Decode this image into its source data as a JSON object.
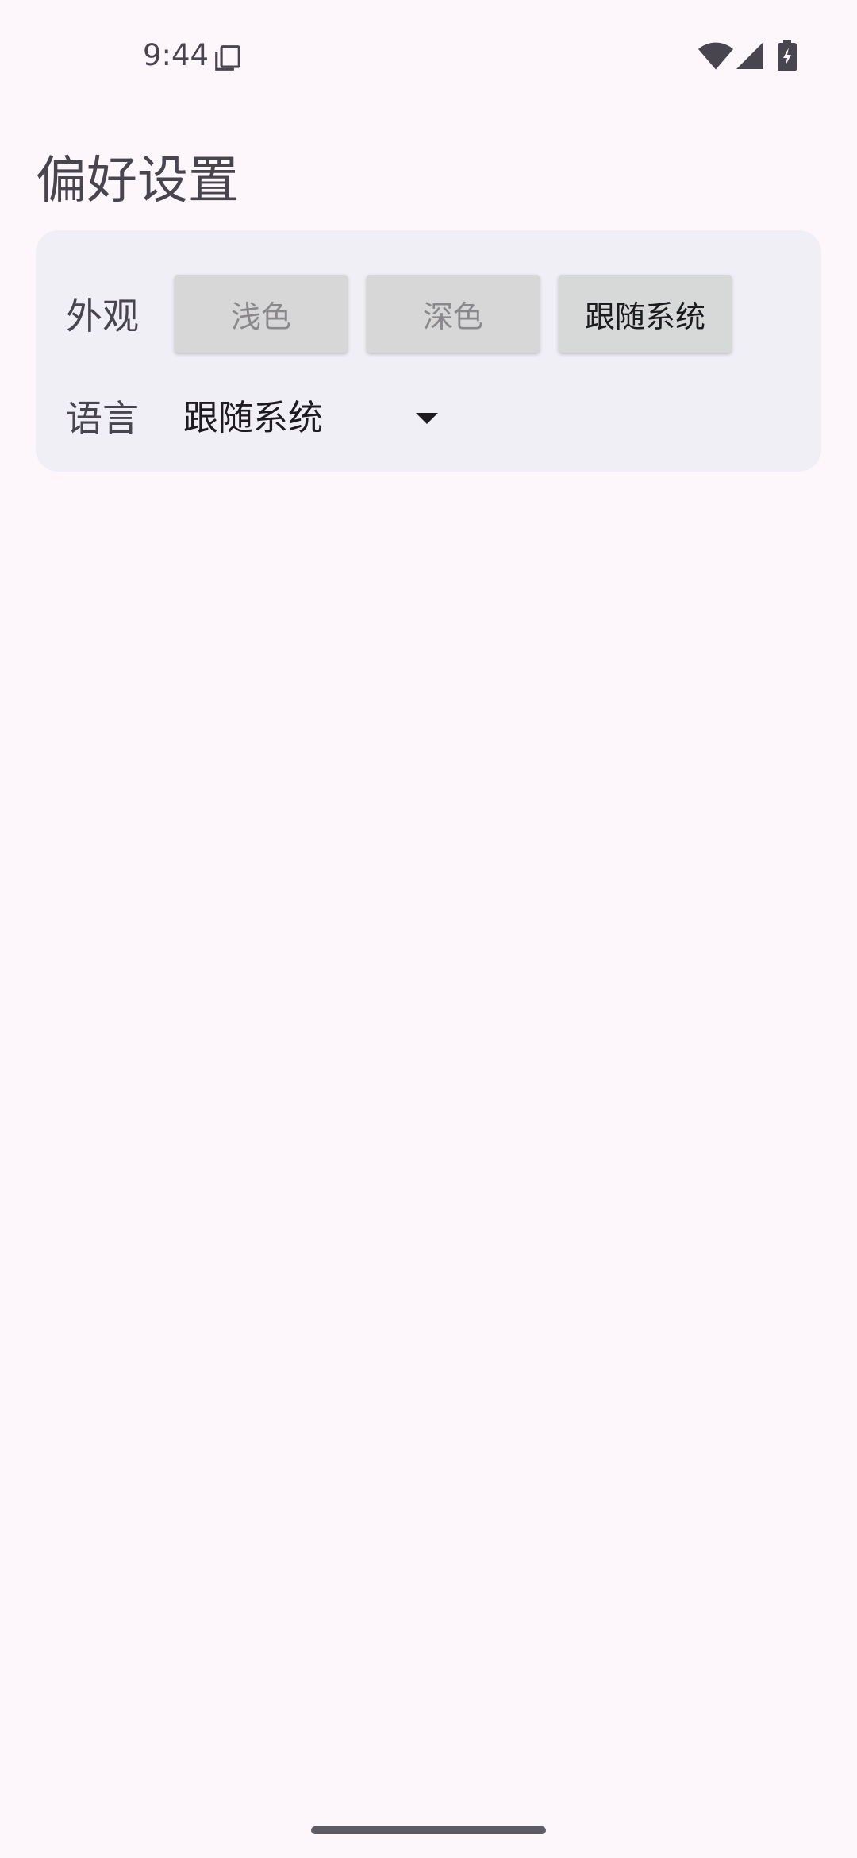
{
  "status_bar": {
    "time": "9:44",
    "icons": [
      "copy-icon",
      "wifi-icon",
      "signal-icon",
      "battery-charging-icon"
    ]
  },
  "page": {
    "title": "偏好设置"
  },
  "appearance": {
    "label": "外观",
    "options": [
      {
        "label": "浅色",
        "selected": false
      },
      {
        "label": "深色",
        "selected": false
      },
      {
        "label": "跟随系统",
        "selected": true
      }
    ]
  },
  "language": {
    "label": "语言",
    "selected_value": "跟随系统"
  },
  "colors": {
    "background": "#fdf7fc",
    "card": "#f1eff6",
    "button": "#d7d7d8",
    "text_primary": "#1d1b20",
    "text_secondary": "#49454f"
  }
}
